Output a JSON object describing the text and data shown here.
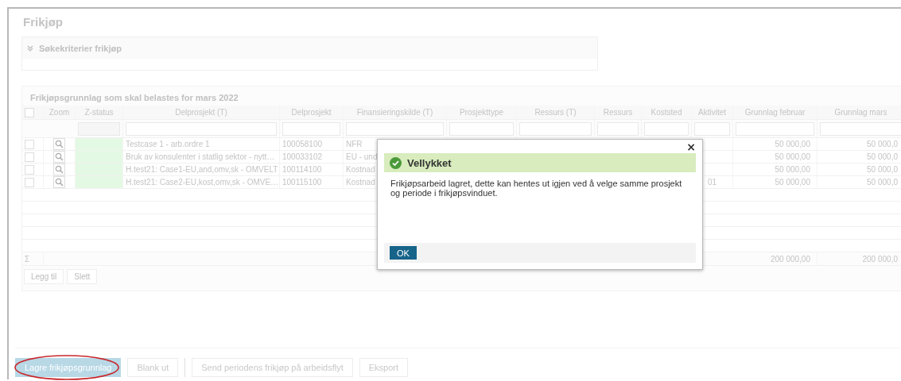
{
  "page_title": "Frikjøp",
  "search_panel": {
    "title": "Søkekriterier frikjøp",
    "expanded": false
  },
  "table": {
    "title": "Frikjøpsgrunnlag som skal belastes for mars 2022",
    "select_all_checked": false,
    "columns": [
      "Zoom",
      "Z-status",
      "Delprosjekt (T)",
      "Delprosjekt",
      "Finansieringskilde (T)",
      "Prosjekttype",
      "Ressurs (T)",
      "Ressurs",
      "Koststed",
      "Aktivitet",
      "Grunnlag februar",
      "Grunnlag mars"
    ],
    "rows": [
      {
        "checked": false,
        "delprosjekt_t": "Testcase 1 - arb.ordre 1",
        "delprosjekt": "100058100",
        "finansieringskilde": "NFR",
        "aktivitet": "",
        "grunnlag_februar": "50 000,00",
        "grunnlag_mars": "50 000,0"
      },
      {
        "checked": false,
        "delprosjekt_t": "Bruk av konsulenter i statlig sektor - nytt…",
        "delprosjekt": "100033102",
        "finansieringskilde": "EU - und",
        "aktivitet": "",
        "grunnlag_februar": "50 000,00",
        "grunnlag_mars": "50 000,0"
      },
      {
        "checked": false,
        "delprosjekt_t": "H.test21: Case1-EU,and,omv,sk - OMVELT",
        "delprosjekt": "100114100",
        "finansieringskilde": "Kostnad",
        "aktivitet": "",
        "grunnlag_februar": "50 000,00",
        "grunnlag_mars": "50 000,0"
      },
      {
        "checked": false,
        "delprosjekt_t": "H.test21: Case2-EU,kost,omv,sk - OMVE…",
        "delprosjekt": "100115100",
        "finansieringskilde": "Kostnad",
        "aktivitet": "01",
        "grunnlag_februar": "50 000,00",
        "grunnlag_mars": "50 000,0"
      }
    ],
    "sum_symbol": "Σ",
    "sum_februar": "200 000,00",
    "sum_mars": "200 000,0",
    "buttons": [
      "Legg til",
      "Slett"
    ]
  },
  "toolbar": [
    {
      "label": "Lagre frikjøpsgrunnlag",
      "highlighted": true,
      "primary": true
    },
    {
      "label": "Blank ut",
      "highlighted": false,
      "primary": false
    },
    {
      "label": "Send periodens frikjøp på arbeidsflyt",
      "highlighted": false,
      "primary": false
    },
    {
      "label": "Eksport",
      "highlighted": false,
      "primary": false
    }
  ],
  "dialog": {
    "close": "×",
    "title": "Vellykket",
    "message": "Frikjøpsarbeid lagret, dette kan hentes ut igjen ved å velge samme prosjekt og periode i frikjøpsvinduet.",
    "button": "OK"
  }
}
